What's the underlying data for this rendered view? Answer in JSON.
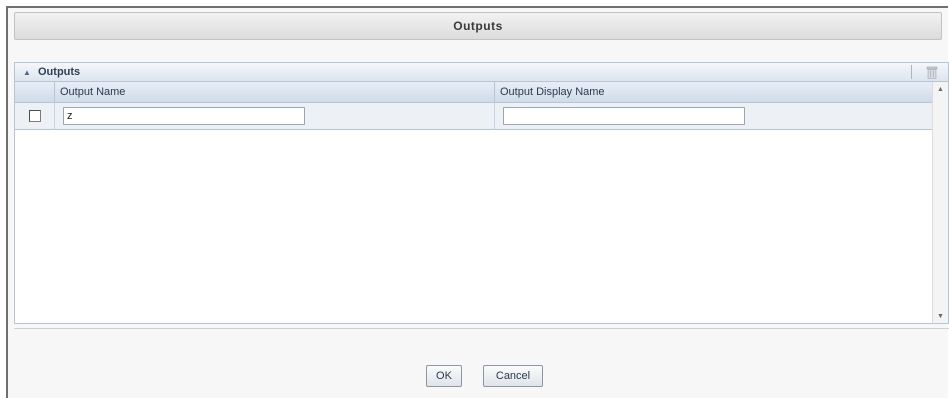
{
  "dialog": {
    "title": "Outputs"
  },
  "panel": {
    "title": "Outputs",
    "collapse_icon": "chevron-up-icon",
    "delete_icon": "trash-icon"
  },
  "grid": {
    "columns": [
      "",
      "Output Name",
      "Output Display Name"
    ],
    "rows": [
      {
        "checked": false,
        "output_name": "z",
        "output_display_name": ""
      }
    ]
  },
  "footer": {
    "ok_label": "OK",
    "cancel_label": "Cancel"
  }
}
